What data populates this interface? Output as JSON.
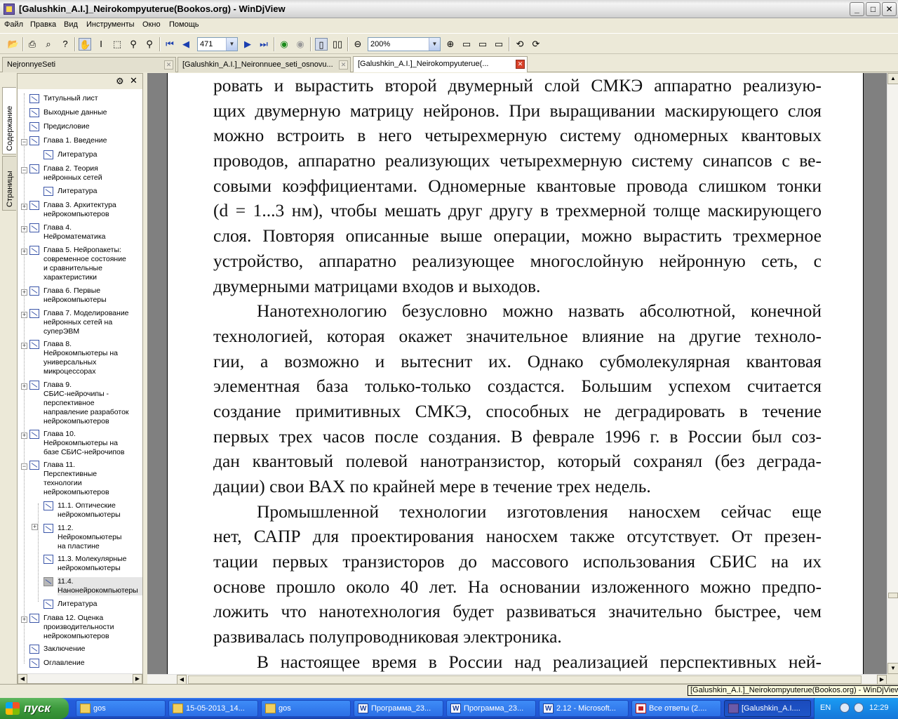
{
  "window": {
    "title": "[Galushkin_A.I.]_Neirokompyuterue(Bookos.org) - WinDjView"
  },
  "menu": [
    "Файл",
    "Правка",
    "Вид",
    "Инструменты",
    "Окно",
    "Помощь"
  ],
  "toolbar": {
    "page_number": "471",
    "zoom": "200%"
  },
  "tabs": [
    {
      "label": "NejronnyeSeti",
      "active": false
    },
    {
      "label": "[Galushkin_A.I.]_Neironnuee_seti_osnovu...",
      "active": false
    },
    {
      "label": "[Galushkin_A.I.]_Neirokompyuterue(...",
      "active": true
    }
  ],
  "side_tabs": {
    "contents": "Содержание",
    "pages": "Страницы"
  },
  "toc": [
    "Титульный лист",
    "Выходные данные",
    "Предисловие",
    "Глава 1. Введение",
    "Литература",
    "Глава 2. Теория\nнейронных сетей",
    "Литература",
    "Глава 3. Архитектура\nнейрокомпьютеров",
    "Глава 4.\nНейроматематика",
    "Глава 5. Нейропакеты:\nсовременное состояние\nи сравнительные\nхарактеристики",
    "Глава 6. Первые\nнейрокомпьютеры",
    "Глава 7. Моделирование\nнейронных сетей на\nсуперЭВМ",
    "Глава 8.\nНейрокомпьютеры на\nуниверсальных\nмикроцессорах",
    "Глава 9.\nСБИС-нейрочипы -\nперспективное\nнаправление разработок\nнейрокомпьютеров",
    "Глава 10.\nНейрокомпьютеры на\nбазе СБИС-нейрочипов",
    "Глава 11.\nПерспективные\nтехнологии\nнейрокомпьютеров",
    "11.1. Оптические\nнейрокомпьютеры",
    "11.2.\nНейрокомпьютеры\nна пластине",
    "11.3. Молекулярные\nнейрокомпьютеры",
    "11.4.\nНанонейрокомпьютеры",
    "Литература",
    "Глава 12. Оценка\nпроизводительности\nнейрокомпьютеров",
    "Заключение",
    "Оглавление"
  ],
  "document_lines": [
    "ровать и вырастить второй двумерный слой СМКЭ аппаратно реализую-",
    "щих двумерную матрицу нейронов. При выращивании маскирующего слоя",
    "можно встроить в него четырехмерную систему одномерных квантовых",
    "проводов, аппаратно реализующих четырехмерную систему синапсов с ве-",
    "совыми коэффициентами. Одномерные квантовые провода слишком тонки",
    "(d = 1...3 нм), чтобы мешать друг другу в трехмерной толще маскирующего",
    "слоя. Повторяя описанные выше операции, можно вырастить трехмерное",
    "устройство, аппаратно реализующее многослойную нейронную сеть, с",
    "двумерными матрицами входов и выходов.",
    "Нанотехнологию безусловно можно назвать абсолютной, конечной",
    "технологией, которая окажет значительное влияние на другие техноло-",
    "гии, а возможно и вытеснит их. Однако субмолекулярная квантовая",
    "элементная база только-только создастся. Большим успехом считается",
    "создание примитивных СМКЭ, способных не деградировать в течение",
    "первых трех часов после создания. В феврале 1996 г. в России был соз-",
    "дан квантовый полевой нанотранзистор, который сохранял (без деграда-",
    "дации) свои ВАХ по крайней мере в течение трех недель.",
    "Промышленной технологии изготовления наносхем сейчас еще",
    "нет, САПР для проектирования наносхем также отсутствует. От презен-",
    "тации первых транзисторов до массового использования СБИС на их",
    "основе прошло около 40 лет. На основании изложенного можно предпо-",
    "ложить что нанотехнология будет развиваться значительно быстрее, чем",
    "развивалась полупроводниковая электроника.",
    "В настоящее время в России над реализацией перспективных ней-"
  ],
  "tooltip": "[Galushkin_A.I.]_Neirokompyuterue(Bookos.org) - WinDjView",
  "taskbar": {
    "start": "пуск",
    "items": [
      {
        "label": "gos",
        "icon": "folder"
      },
      {
        "label": "15-05-2013_14...",
        "icon": "folder"
      },
      {
        "label": "gos",
        "icon": "folder"
      },
      {
        "label": "Программа_23...",
        "icon": "word"
      },
      {
        "label": "Программа_23...",
        "icon": "word"
      },
      {
        "label": "2.12 - Microsoft...",
        "icon": "word"
      },
      {
        "label": "Все ответы (2....",
        "icon": "pdf"
      },
      {
        "label": "[Galushkin_A.I....",
        "icon": "djv"
      }
    ],
    "lang": "EN",
    "clock": "12:29"
  }
}
